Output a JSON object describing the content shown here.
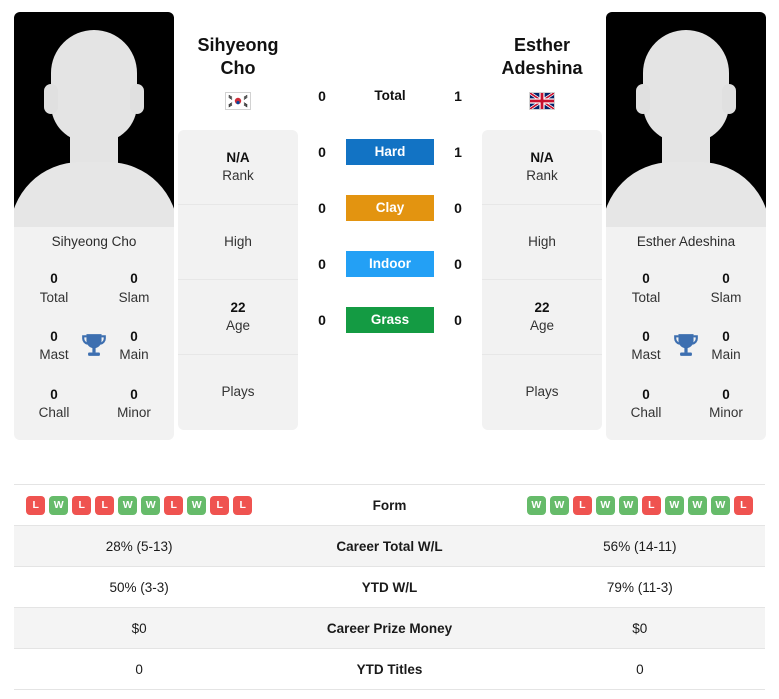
{
  "colors": {
    "hard": "#1273c4",
    "clay": "#e39410",
    "indoor": "#23a0f5",
    "grass": "#149b43",
    "win": "#66bb6a",
    "loss": "#ef5350",
    "trophy": "#3d6fb0"
  },
  "players": {
    "left": {
      "first_name": "Sihyeong",
      "last_name": "Cho",
      "full_name": "Sihyeong Cho",
      "country": "South Korea",
      "flag_icon": "flag-south-korea",
      "titles": [
        {
          "num": "0",
          "label": "Total"
        },
        {
          "num": "0",
          "label": "Slam"
        },
        {
          "num": "0",
          "label": "Mast"
        },
        {
          "num": "0",
          "label": "Main"
        },
        {
          "num": "0",
          "label": "Chall"
        },
        {
          "num": "0",
          "label": "Minor"
        }
      ],
      "rank_value": "N/A",
      "rank_label": "Rank",
      "high_value": "",
      "high_label": "High",
      "age_value": "22",
      "age_label": "Age",
      "plays_value": "",
      "plays_label": "Plays",
      "form": [
        "L",
        "W",
        "L",
        "L",
        "W",
        "W",
        "L",
        "W",
        "L",
        "L"
      ],
      "career_total_wl": "28% (5-13)",
      "ytd_wl": "50% (3-3)",
      "career_prize_money": "$0",
      "ytd_titles": "0"
    },
    "right": {
      "first_name": "Esther",
      "last_name": "Adeshina",
      "full_name": "Esther Adeshina",
      "country": "United Kingdom",
      "flag_icon": "flag-united-kingdom",
      "titles": [
        {
          "num": "0",
          "label": "Total"
        },
        {
          "num": "0",
          "label": "Slam"
        },
        {
          "num": "0",
          "label": "Mast"
        },
        {
          "num": "0",
          "label": "Main"
        },
        {
          "num": "0",
          "label": "Chall"
        },
        {
          "num": "0",
          "label": "Minor"
        }
      ],
      "rank_value": "N/A",
      "rank_label": "Rank",
      "high_value": "",
      "high_label": "High",
      "age_value": "22",
      "age_label": "Age",
      "plays_value": "",
      "plays_label": "Plays",
      "form": [
        "W",
        "W",
        "L",
        "W",
        "W",
        "L",
        "W",
        "W",
        "W",
        "L"
      ],
      "career_total_wl": "56% (14-11)",
      "ytd_wl": "79% (11-3)",
      "career_prize_money": "$0",
      "ytd_titles": "0"
    }
  },
  "head_to_head": [
    {
      "label": "Total",
      "left": "0",
      "right": "1",
      "style": "plain"
    },
    {
      "label": "Hard",
      "left": "0",
      "right": "1",
      "style": "hard"
    },
    {
      "label": "Clay",
      "left": "0",
      "right": "0",
      "style": "clay"
    },
    {
      "label": "Indoor",
      "left": "0",
      "right": "0",
      "style": "indoor"
    },
    {
      "label": "Grass",
      "left": "0",
      "right": "0",
      "style": "grass"
    }
  ],
  "table": {
    "rows": [
      {
        "label": "Form",
        "type": "form"
      },
      {
        "label": "Career Total W/L",
        "type": "text",
        "left": "28% (5-13)",
        "right": "56% (14-11)"
      },
      {
        "label": "YTD W/L",
        "type": "text",
        "left": "50% (3-3)",
        "right": "79% (11-3)"
      },
      {
        "label": "Career Prize Money",
        "type": "text",
        "left": "$0",
        "right": "$0"
      },
      {
        "label": "YTD Titles",
        "type": "text",
        "left": "0",
        "right": "0"
      }
    ]
  }
}
